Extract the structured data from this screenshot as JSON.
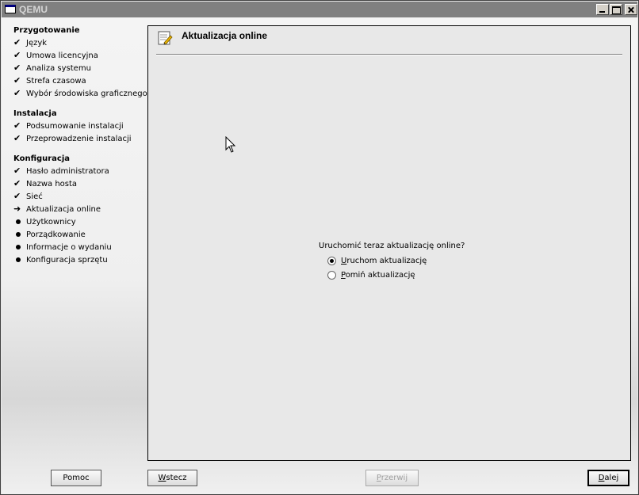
{
  "window": {
    "title": "QEMU"
  },
  "sidebar": {
    "sections": [
      {
        "title": "Przygotowanie",
        "steps": [
          {
            "label": "Język",
            "state": "done"
          },
          {
            "label": "Umowa licencyjna",
            "state": "done"
          },
          {
            "label": "Analiza systemu",
            "state": "done"
          },
          {
            "label": "Strefa czasowa",
            "state": "done"
          },
          {
            "label": "Wybór środowiska graficznego",
            "state": "done"
          }
        ]
      },
      {
        "title": "Instalacja",
        "steps": [
          {
            "label": "Podsumowanie instalacji",
            "state": "done"
          },
          {
            "label": "Przeprowadzenie instalacji",
            "state": "done"
          }
        ]
      },
      {
        "title": "Konfiguracja",
        "steps": [
          {
            "label": "Hasło administratora",
            "state": "done"
          },
          {
            "label": "Nazwa hosta",
            "state": "done"
          },
          {
            "label": "Sieć",
            "state": "done"
          },
          {
            "label": "Aktualizacja online",
            "state": "current"
          },
          {
            "label": "Użytkownicy",
            "state": "pending"
          },
          {
            "label": "Porządkowanie",
            "state": "pending"
          },
          {
            "label": "Informacje o wydaniu",
            "state": "pending"
          },
          {
            "label": "Konfiguracja sprzętu",
            "state": "pending"
          }
        ]
      }
    ]
  },
  "main": {
    "title": "Aktualizacja online",
    "question": "Uruchomić teraz aktualizację online?",
    "options": [
      {
        "mnemonic": "U",
        "rest": "ruchom aktualizację",
        "checked": true
      },
      {
        "mnemonic": "P",
        "rest": "omiń aktualizację",
        "checked": false
      }
    ]
  },
  "buttons": {
    "help": "Pomoc",
    "back_mnemonic": "W",
    "back_rest": "stecz",
    "abort_mnemonic": "P",
    "abort_rest": "rzerwij",
    "next_mnemonic": "D",
    "next_rest": "alej"
  },
  "icons": {
    "done": "check-icon",
    "current": "arrow-right-icon",
    "pending": "bullet-icon"
  }
}
